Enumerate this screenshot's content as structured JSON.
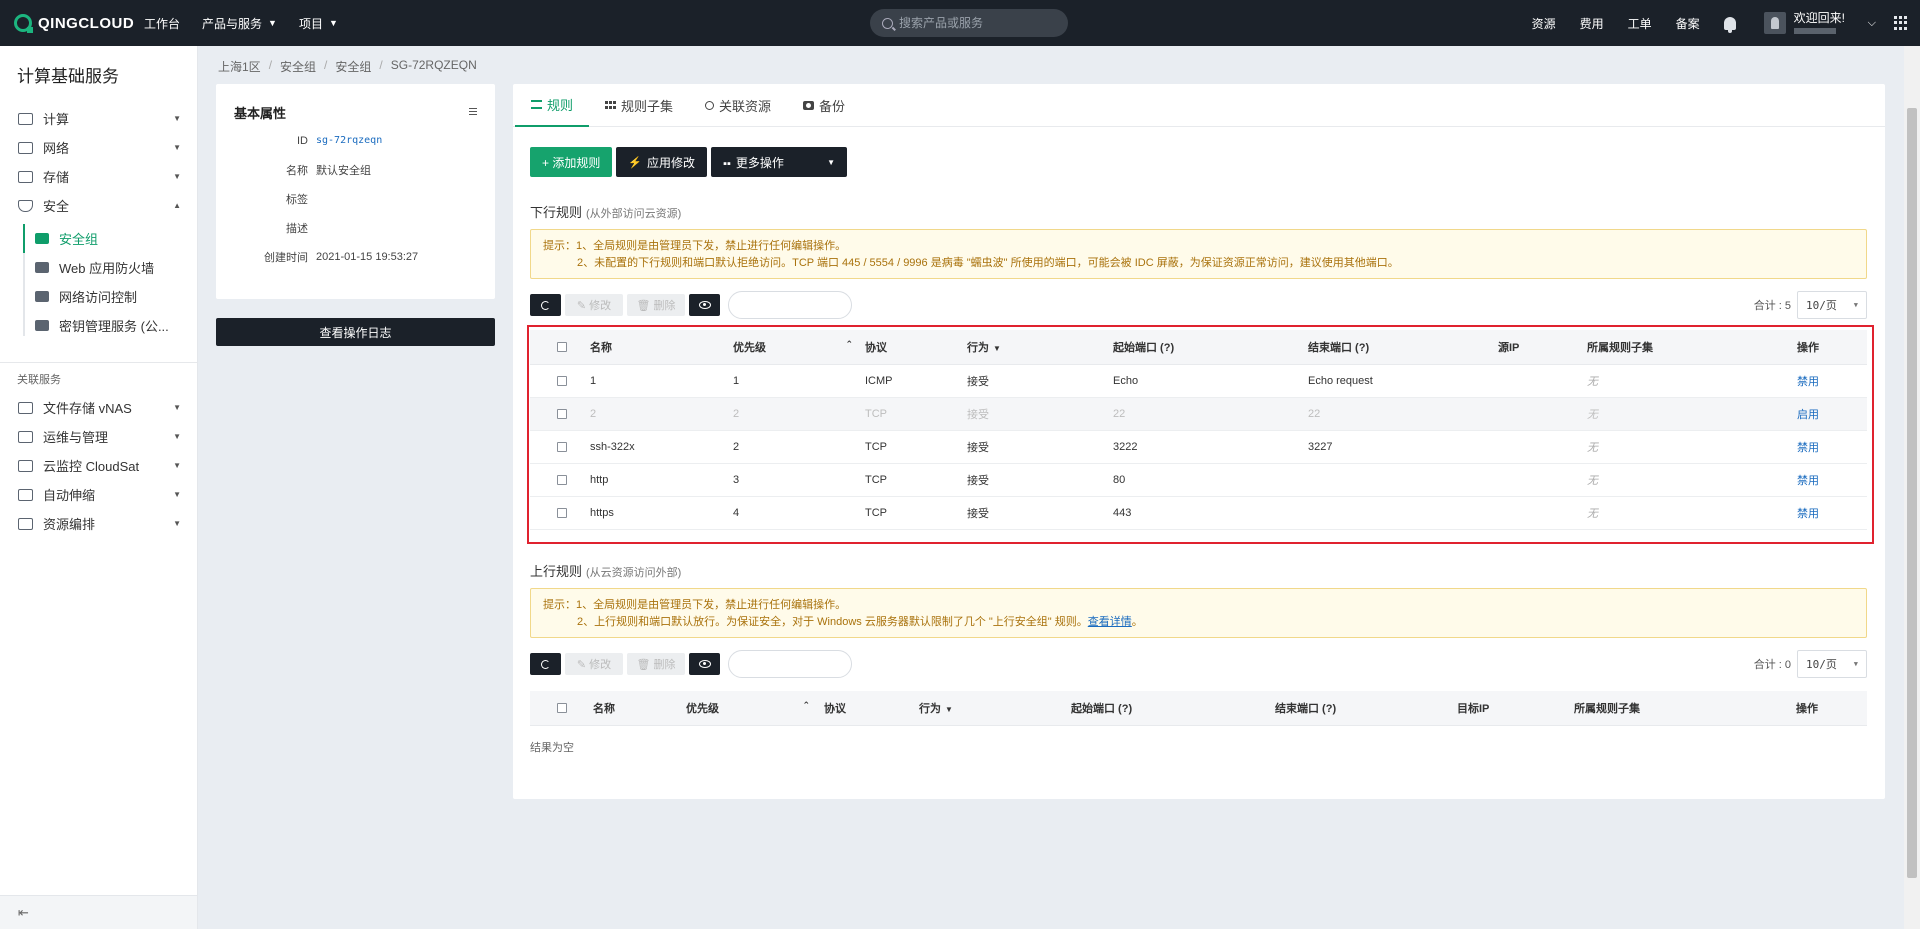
{
  "topbar": {
    "logo": "QINGCLOUD",
    "nav": [
      "工作台",
      "产品与服务",
      "项目"
    ],
    "search_placeholder": "搜索产品或服务",
    "links": [
      "资源",
      "费用",
      "工单",
      "备案"
    ],
    "welcome": "欢迎回来!"
  },
  "sidebar": {
    "title": "计算基础服务",
    "items": [
      "计算",
      "网络",
      "存储",
      "安全"
    ],
    "security_subitems": [
      "安全组",
      "Web 应用防火墙",
      "网络访问控制",
      "密钥管理服务 (公..."
    ],
    "section_label": "关联服务",
    "related": [
      "文件存储 vNAS",
      "运维与管理",
      "云监控 CloudSat",
      "自动伸缩",
      "资源编排"
    ],
    "collapse_icon": "⇤"
  },
  "breadcrumb": [
    "上海1区",
    "安全组",
    "安全组",
    "SG-72RQZEQN"
  ],
  "info": {
    "title": "基本属性",
    "rows": [
      {
        "k": "ID",
        "v": "sg-72rqzeqn"
      },
      {
        "k": "名称",
        "v": "默认安全组"
      },
      {
        "k": "标签",
        "v": ""
      },
      {
        "k": "描述",
        "v": ""
      },
      {
        "k": "创建时间",
        "v": "2021-01-15 19:53:27"
      }
    ],
    "oplog_button": "查看操作日志"
  },
  "tabs": [
    "规则",
    "规则子集",
    "关联资源",
    "备份"
  ],
  "actions": {
    "add": "+ 添加规则",
    "apply": "应用修改",
    "more": "更多操作"
  },
  "downlink": {
    "title": "下行规则",
    "hint": "(从外部访问云资源)",
    "notice_line1": "提示：1、全局规则是由管理员下发，禁止进行任何编辑操作。",
    "notice_line2": "2、未配置的下行规则和端口默认拒绝访问。TCP 端口 445 / 5554 / 9996 是病毒 \"蠕虫波\" 所使用的端口，可能会被 IDC 屏蔽，为保证资源正常访问，建议使用其他端口。",
    "edit_label": "✎ 修改",
    "delete_label": "🗑 删除",
    "count": "合计 : 5",
    "pager": "10/页",
    "headers": [
      "名称",
      "优先级",
      "协议",
      "行为",
      "起始端口 (?)",
      "结束端口 (?)",
      "源IP",
      "所属规则子集",
      "操作"
    ],
    "rows": [
      {
        "name": "1",
        "priority": "1",
        "protocol": "ICMP",
        "action": "接受",
        "start": "Echo",
        "end": "Echo request",
        "ip": "",
        "subset": "无",
        "op": "禁用",
        "disabled": false
      },
      {
        "name": "2",
        "priority": "2",
        "protocol": "TCP",
        "action": "接受",
        "start": "22",
        "end": "22",
        "ip": "",
        "subset": "无",
        "op": "启用",
        "disabled": true
      },
      {
        "name": "ssh-322x",
        "priority": "2",
        "protocol": "TCP",
        "action": "接受",
        "start": "3222",
        "end": "3227",
        "ip": "",
        "subset": "无",
        "op": "禁用",
        "disabled": false
      },
      {
        "name": "http",
        "priority": "3",
        "protocol": "TCP",
        "action": "接受",
        "start": "80",
        "end": "",
        "ip": "",
        "subset": "无",
        "op": "禁用",
        "disabled": false
      },
      {
        "name": "https",
        "priority": "4",
        "protocol": "TCP",
        "action": "接受",
        "start": "443",
        "end": "",
        "ip": "",
        "subset": "无",
        "op": "禁用",
        "disabled": false
      }
    ]
  },
  "uplink": {
    "title": "上行规则",
    "hint": "(从云资源访问外部)",
    "notice_line1": "提示：1、全局规则是由管理员下发，禁止进行任何编辑操作。",
    "notice_line2": "2、上行规则和端口默认放行。为保证安全，对于 Windows 云服务器默认限制了几个 \"上行安全组\" 规则。",
    "notice_link": "查看详情",
    "edit_label": "✎ 修改",
    "delete_label": "🗑 删除",
    "count": "合计 : 0",
    "pager": "10/页",
    "headers": [
      "名称",
      "优先级",
      "协议",
      "行为",
      "起始端口 (?)",
      "结束端口 (?)",
      "目标IP",
      "所属规则子集",
      "操作"
    ],
    "empty": "结果为空"
  }
}
